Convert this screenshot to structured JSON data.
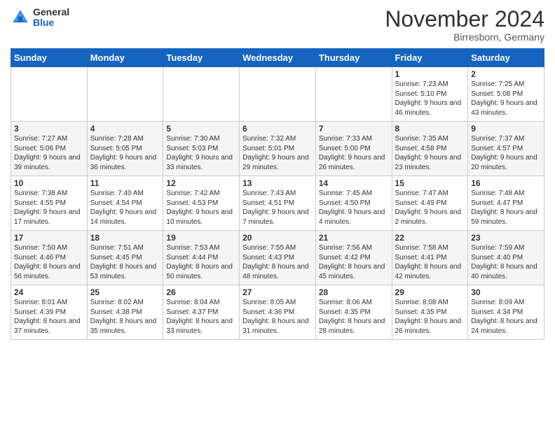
{
  "header": {
    "logo_general": "General",
    "logo_blue": "Blue",
    "month_title": "November 2024",
    "location": "Birresborn, Germany"
  },
  "weekdays": [
    "Sunday",
    "Monday",
    "Tuesday",
    "Wednesday",
    "Thursday",
    "Friday",
    "Saturday"
  ],
  "weeks": [
    [
      {
        "day": "",
        "info": ""
      },
      {
        "day": "",
        "info": ""
      },
      {
        "day": "",
        "info": ""
      },
      {
        "day": "",
        "info": ""
      },
      {
        "day": "",
        "info": ""
      },
      {
        "day": "1",
        "info": "Sunrise: 7:23 AM\nSunset: 5:10 PM\nDaylight: 9 hours and 46 minutes."
      },
      {
        "day": "2",
        "info": "Sunrise: 7:25 AM\nSunset: 5:08 PM\nDaylight: 9 hours and 43 minutes."
      }
    ],
    [
      {
        "day": "3",
        "info": "Sunrise: 7:27 AM\nSunset: 5:06 PM\nDaylight: 9 hours and 39 minutes."
      },
      {
        "day": "4",
        "info": "Sunrise: 7:28 AM\nSunset: 5:05 PM\nDaylight: 9 hours and 36 minutes."
      },
      {
        "day": "5",
        "info": "Sunrise: 7:30 AM\nSunset: 5:03 PM\nDaylight: 9 hours and 33 minutes."
      },
      {
        "day": "6",
        "info": "Sunrise: 7:32 AM\nSunset: 5:01 PM\nDaylight: 9 hours and 29 minutes."
      },
      {
        "day": "7",
        "info": "Sunrise: 7:33 AM\nSunset: 5:00 PM\nDaylight: 9 hours and 26 minutes."
      },
      {
        "day": "8",
        "info": "Sunrise: 7:35 AM\nSunset: 4:58 PM\nDaylight: 9 hours and 23 minutes."
      },
      {
        "day": "9",
        "info": "Sunrise: 7:37 AM\nSunset: 4:57 PM\nDaylight: 9 hours and 20 minutes."
      }
    ],
    [
      {
        "day": "10",
        "info": "Sunrise: 7:38 AM\nSunset: 4:55 PM\nDaylight: 9 hours and 17 minutes."
      },
      {
        "day": "11",
        "info": "Sunrise: 7:40 AM\nSunset: 4:54 PM\nDaylight: 9 hours and 14 minutes."
      },
      {
        "day": "12",
        "info": "Sunrise: 7:42 AM\nSunset: 4:53 PM\nDaylight: 9 hours and 10 minutes."
      },
      {
        "day": "13",
        "info": "Sunrise: 7:43 AM\nSunset: 4:51 PM\nDaylight: 9 hours and 7 minutes."
      },
      {
        "day": "14",
        "info": "Sunrise: 7:45 AM\nSunset: 4:50 PM\nDaylight: 9 hours and 4 minutes."
      },
      {
        "day": "15",
        "info": "Sunrise: 7:47 AM\nSunset: 4:49 PM\nDaylight: 9 hours and 2 minutes."
      },
      {
        "day": "16",
        "info": "Sunrise: 7:48 AM\nSunset: 4:47 PM\nDaylight: 8 hours and 59 minutes."
      }
    ],
    [
      {
        "day": "17",
        "info": "Sunrise: 7:50 AM\nSunset: 4:46 PM\nDaylight: 8 hours and 56 minutes."
      },
      {
        "day": "18",
        "info": "Sunrise: 7:51 AM\nSunset: 4:45 PM\nDaylight: 8 hours and 53 minutes."
      },
      {
        "day": "19",
        "info": "Sunrise: 7:53 AM\nSunset: 4:44 PM\nDaylight: 8 hours and 50 minutes."
      },
      {
        "day": "20",
        "info": "Sunrise: 7:55 AM\nSunset: 4:43 PM\nDaylight: 8 hours and 48 minutes."
      },
      {
        "day": "21",
        "info": "Sunrise: 7:56 AM\nSunset: 4:42 PM\nDaylight: 8 hours and 45 minutes."
      },
      {
        "day": "22",
        "info": "Sunrise: 7:58 AM\nSunset: 4:41 PM\nDaylight: 8 hours and 42 minutes."
      },
      {
        "day": "23",
        "info": "Sunrise: 7:59 AM\nSunset: 4:40 PM\nDaylight: 8 hours and 40 minutes."
      }
    ],
    [
      {
        "day": "24",
        "info": "Sunrise: 8:01 AM\nSunset: 4:39 PM\nDaylight: 8 hours and 37 minutes."
      },
      {
        "day": "25",
        "info": "Sunrise: 8:02 AM\nSunset: 4:38 PM\nDaylight: 8 hours and 35 minutes."
      },
      {
        "day": "26",
        "info": "Sunrise: 8:04 AM\nSunset: 4:37 PM\nDaylight: 8 hours and 33 minutes."
      },
      {
        "day": "27",
        "info": "Sunrise: 8:05 AM\nSunset: 4:36 PM\nDaylight: 8 hours and 31 minutes."
      },
      {
        "day": "28",
        "info": "Sunrise: 8:06 AM\nSunset: 4:35 PM\nDaylight: 8 hours and 28 minutes."
      },
      {
        "day": "29",
        "info": "Sunrise: 8:08 AM\nSunset: 4:35 PM\nDaylight: 8 hours and 26 minutes."
      },
      {
        "day": "30",
        "info": "Sunrise: 8:09 AM\nSunset: 4:34 PM\nDaylight: 8 hours and 24 minutes."
      }
    ]
  ]
}
